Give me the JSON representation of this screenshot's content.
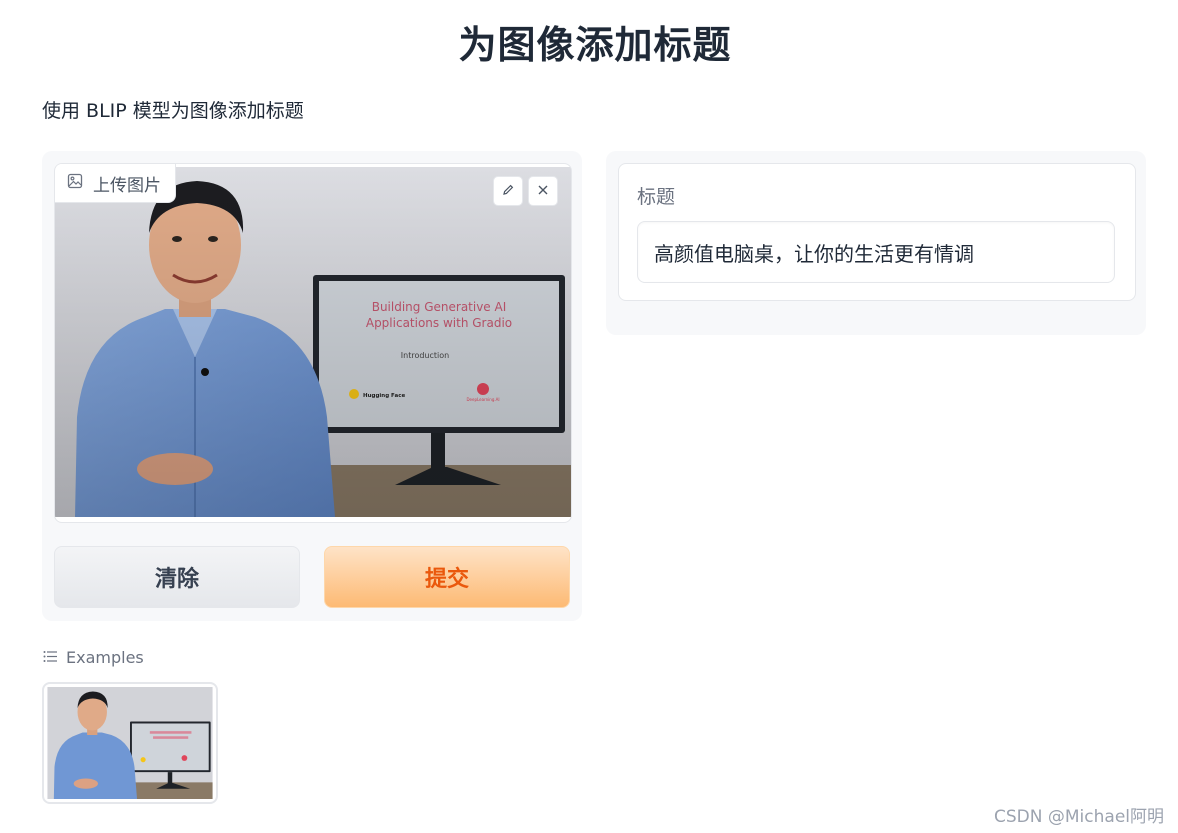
{
  "page": {
    "title": "为图像添加标题",
    "description": "使用 BLIP 模型为图像添加标题"
  },
  "image_input": {
    "label": "上传图片",
    "tools": [
      "edit-icon",
      "close-icon"
    ],
    "slide": {
      "title_line1": "Building Generative AI",
      "title_line2": "Applications with Gradio",
      "subtitle": "Introduction",
      "logo_left": "Hugging Face",
      "logo_right": "DeepLearning.AI"
    }
  },
  "buttons": {
    "clear": "清除",
    "submit": "提交"
  },
  "output": {
    "label": "标题",
    "value": "高颜值电脑桌，让你的生活更有情调"
  },
  "examples": {
    "label": "Examples"
  },
  "watermark": "CSDN @Michael阿明",
  "colors": {
    "submit_bg": "#fdba74",
    "submit_text": "#ea580c",
    "panel_bg": "#f7f8fa"
  }
}
